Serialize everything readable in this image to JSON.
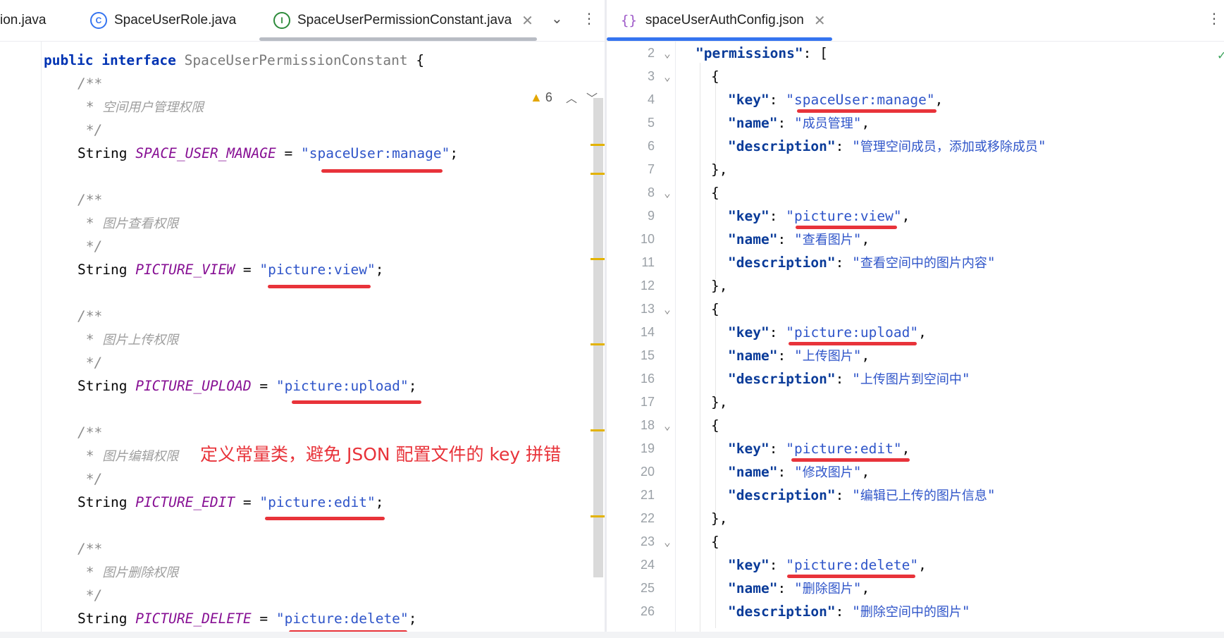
{
  "tabs_left": [
    {
      "label": "ion.java",
      "icon": "java-file-icon",
      "active": false
    },
    {
      "label": "SpaceUserRole.java",
      "icon": "class-icon",
      "glyph": "C",
      "color": "#3574f0",
      "active": false
    },
    {
      "label": "SpaceUserPermissionConstant.java",
      "icon": "interface-icon",
      "glyph": "I",
      "color": "#2c8a3a",
      "active": true
    }
  ],
  "tabs_right": [
    {
      "label": "spaceUserAuthConfig.json",
      "icon": "json-braces-icon",
      "glyph": "{}",
      "color": "#9e59c8",
      "active": true
    }
  ],
  "colors": {
    "accent": "#3574f0",
    "inactive_tab_bar": "#b8bcc4",
    "underline_red": "#e8333a",
    "warning": "#e3b300"
  },
  "left_editor": {
    "warning_count": "6",
    "header": {
      "kw1": "public",
      "kw2": "interface",
      "name": "SpaceUserPermissionConstant",
      "brace": "{"
    },
    "blocks": [
      {
        "comment_open": "/**",
        "comment_text": "空间用户管理权限",
        "comment_close": "*/",
        "type": "String",
        "const": "SPACE_USER_MANAGE",
        "value": "spaceUser:manage"
      },
      {
        "comment_open": "/**",
        "comment_text": "图片查看权限",
        "comment_close": "*/",
        "type": "String",
        "const": "PICTURE_VIEW",
        "value": "picture:view"
      },
      {
        "comment_open": "/**",
        "comment_text": "图片上传权限",
        "comment_close": "*/",
        "type": "String",
        "const": "PICTURE_UPLOAD",
        "value": "picture:upload"
      },
      {
        "comment_open": "/**",
        "comment_text": "图片编辑权限",
        "comment_close": "*/",
        "type": "String",
        "const": "PICTURE_EDIT",
        "value": "picture:edit"
      },
      {
        "comment_open": "/**",
        "comment_text": "图片删除权限",
        "comment_close": "*/",
        "type": "String",
        "const": "PICTURE_DELETE",
        "value": "picture:delete"
      }
    ],
    "annotation": "定义常量类，避免 JSON 配置文件的 key 拼错"
  },
  "right_editor": {
    "line_numbers": [
      "2",
      "3",
      "4",
      "5",
      "6",
      "7",
      "8",
      "9",
      "10",
      "11",
      "12",
      "13",
      "14",
      "15",
      "16",
      "17",
      "18",
      "19",
      "20",
      "21",
      "22",
      "23",
      "24",
      "25",
      "26"
    ],
    "permissions_key": "permissions",
    "entries": [
      {
        "key": "spaceUser:manage",
        "name": "成员管理",
        "description": "管理空间成员，添加或移除成员"
      },
      {
        "key": "picture:view",
        "name": "查看图片",
        "description": "查看空间中的图片内容"
      },
      {
        "key": "picture:upload",
        "name": "上传图片",
        "description": "上传图片到空间中"
      },
      {
        "key": "picture:edit",
        "name": "修改图片",
        "description": "编辑已上传的图片信息"
      },
      {
        "key": "picture:delete",
        "name": "删除图片",
        "description": "删除空间中的图片"
      }
    ],
    "field_labels": {
      "key": "key",
      "name": "name",
      "description": "description"
    }
  }
}
